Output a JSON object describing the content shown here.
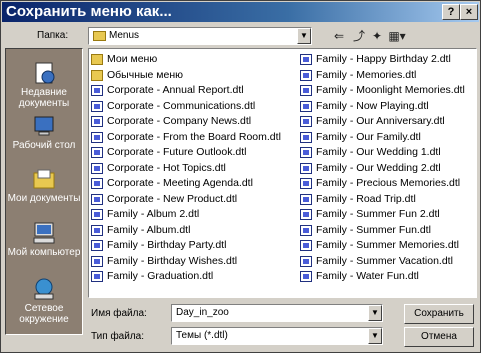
{
  "window": {
    "title": "Сохранить меню как...",
    "help_label": "?",
    "close_label": "×"
  },
  "lookin": {
    "label": "Папка:",
    "value": "Menus"
  },
  "places": [
    {
      "label": "Недавние документы",
      "icon": "recent-documents-icon"
    },
    {
      "label": "Рабочий стол",
      "icon": "desktop-icon"
    },
    {
      "label": "Мои документы",
      "icon": "my-documents-icon"
    },
    {
      "label": "Мой компьютер",
      "icon": "my-computer-icon"
    },
    {
      "label": "Сетевое окружение",
      "icon": "network-places-icon"
    }
  ],
  "files_col1": [
    {
      "name": "Мои меню",
      "type": "folder"
    },
    {
      "name": "Обычные меню",
      "type": "folder"
    },
    {
      "name": "Corporate - Annual Report.dtl",
      "type": "doc"
    },
    {
      "name": "Corporate - Communications.dtl",
      "type": "doc"
    },
    {
      "name": "Corporate - Company News.dtl",
      "type": "doc"
    },
    {
      "name": "Corporate - From the Board Room.dtl",
      "type": "doc"
    },
    {
      "name": "Corporate - Future Outlook.dtl",
      "type": "doc"
    },
    {
      "name": "Corporate - Hot Topics.dtl",
      "type": "doc"
    },
    {
      "name": "Corporate - Meeting Agenda.dtl",
      "type": "doc"
    },
    {
      "name": "Corporate - New Product.dtl",
      "type": "doc"
    },
    {
      "name": "Family - Album 2.dtl",
      "type": "doc"
    },
    {
      "name": "Family - Album.dtl",
      "type": "doc"
    },
    {
      "name": "Family - Birthday Party.dtl",
      "type": "doc"
    },
    {
      "name": "Family - Birthday Wishes.dtl",
      "type": "doc"
    },
    {
      "name": "Family - Graduation.dtl",
      "type": "doc"
    }
  ],
  "files_col2": [
    {
      "name": "Family - Happy Birthday 2.dtl",
      "type": "doc"
    },
    {
      "name": "Family - Memories.dtl",
      "type": "doc"
    },
    {
      "name": "Family - Moonlight Memories.dtl",
      "type": "doc"
    },
    {
      "name": "Family - Now Playing.dtl",
      "type": "doc"
    },
    {
      "name": "Family - Our Anniversary.dtl",
      "type": "doc"
    },
    {
      "name": "Family - Our Family.dtl",
      "type": "doc"
    },
    {
      "name": "Family - Our Wedding 1.dtl",
      "type": "doc"
    },
    {
      "name": "Family - Our Wedding 2.dtl",
      "type": "doc"
    },
    {
      "name": "Family - Precious Memories.dtl",
      "type": "doc"
    },
    {
      "name": "Family - Road Trip.dtl",
      "type": "doc"
    },
    {
      "name": "Family - Summer Fun 2.dtl",
      "type": "doc"
    },
    {
      "name": "Family - Summer Fun.dtl",
      "type": "doc"
    },
    {
      "name": "Family - Summer Memories.dtl",
      "type": "doc"
    },
    {
      "name": "Family - Summer Vacation.dtl",
      "type": "doc"
    },
    {
      "name": "Family - Water Fun.dtl",
      "type": "doc"
    }
  ],
  "filename": {
    "label": "Имя файла:",
    "value": "Day_in_zoo"
  },
  "filetype": {
    "label": "Тип файла:",
    "value": "Темы (*.dtl)"
  },
  "buttons": {
    "save": "Сохранить",
    "cancel": "Отмена"
  }
}
